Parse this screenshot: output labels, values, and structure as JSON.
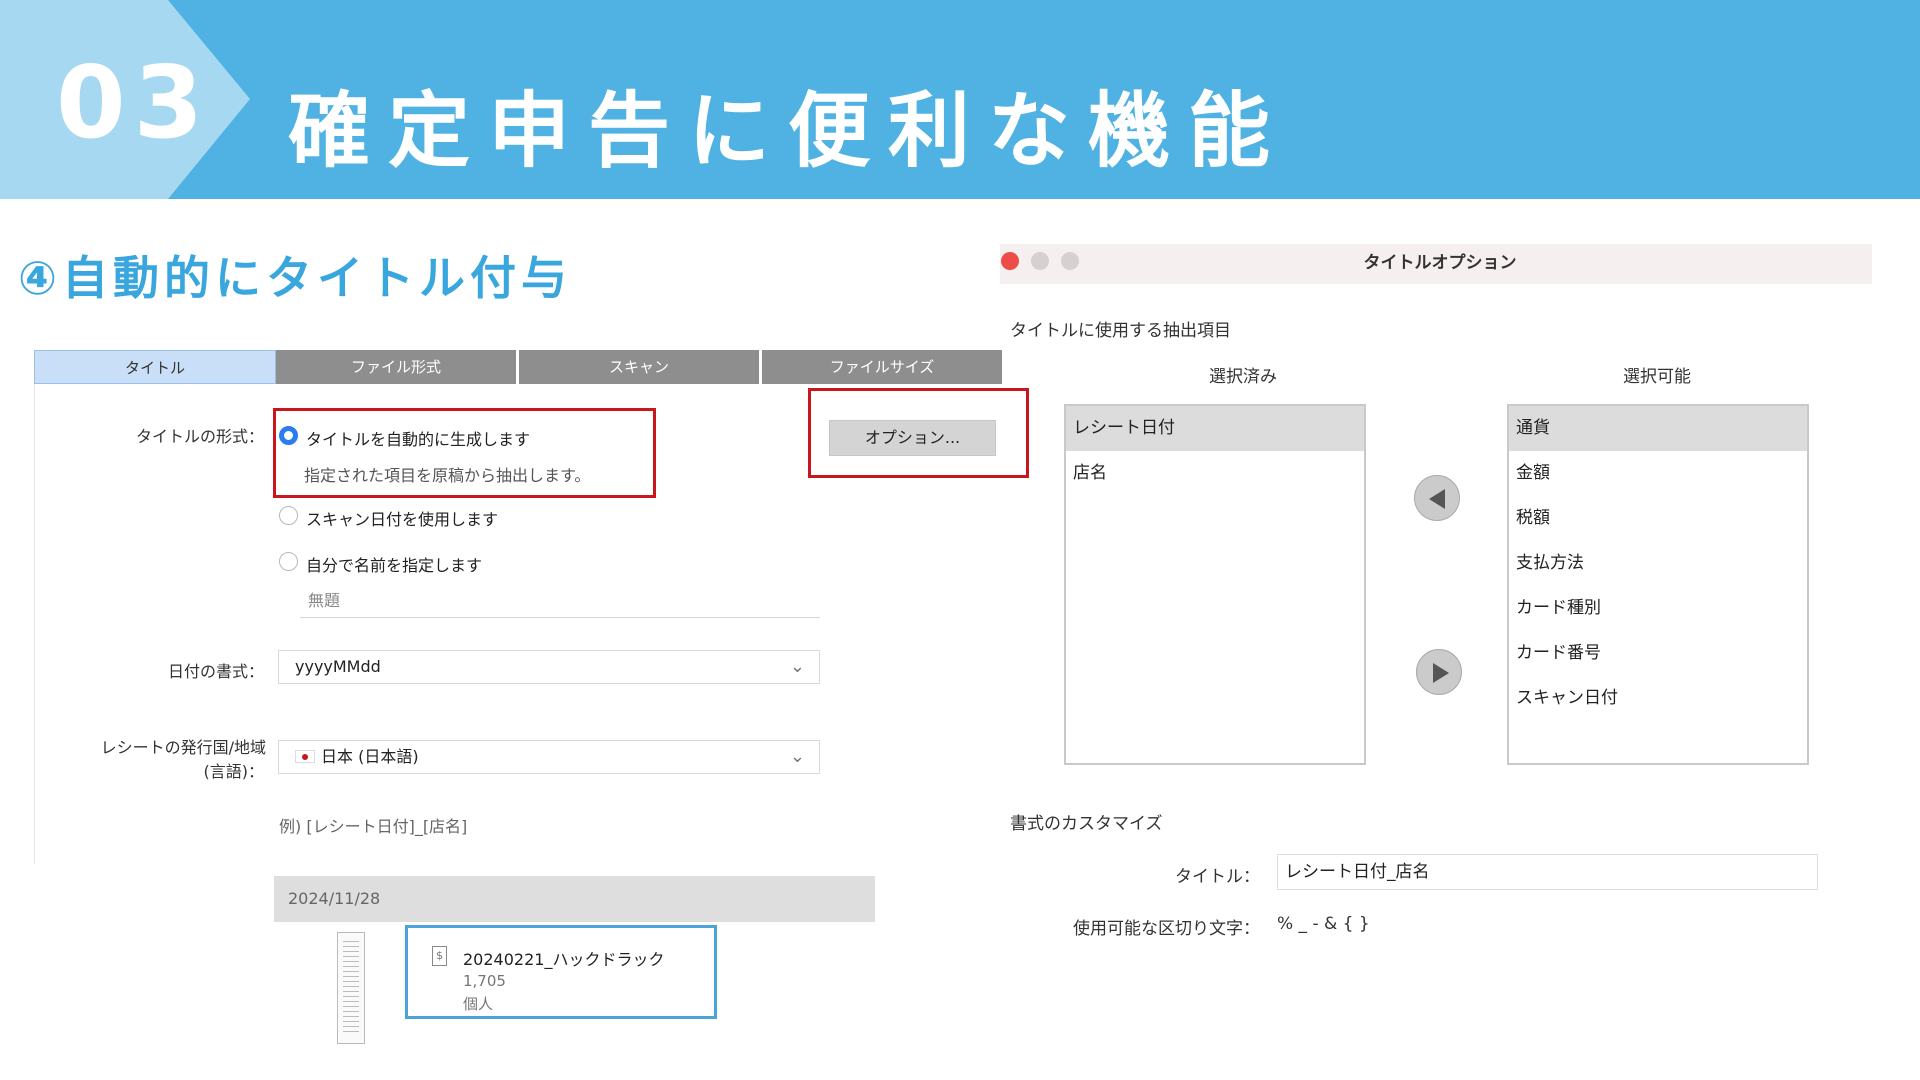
{
  "header": {
    "number": "03",
    "title": "確定申告に便利な機能"
  },
  "section_title": "④自動的にタイトル付与",
  "settings": {
    "tabs": [
      "タイトル",
      "ファイル形式",
      "スキャン",
      "ファイルサイズ"
    ],
    "active_tab": "タイトル",
    "title_format_label": "タイトルの形式：",
    "option_auto": "タイトルを自動的に生成します",
    "option_auto_desc": "指定された項目を原稿から抽出します。",
    "option_scan_date": "スキャン日付を使用します",
    "option_custom": "自分で名前を指定します",
    "custom_placeholder": "無題",
    "options_button": "オプション...",
    "date_format_label": "日付の書式：",
    "date_format_value": "yyyyMMdd",
    "region_label_1": "レシートの発行国/地域",
    "region_label_2": "(言語)：",
    "region_value": "日本 (日本語)",
    "example": "例) [レシート日付]_[店名]"
  },
  "preview": {
    "date": "2024/11/28",
    "doc_title": "20240221_ハックドラック",
    "doc_amount": "1,705",
    "doc_category": "個人",
    "receipt_icon": "receipt-icon"
  },
  "dialog": {
    "title": "タイトルオプション",
    "extraction_heading": "タイトルに使用する抽出項目",
    "selected_heading": "選択済み",
    "available_heading": "選択可能",
    "selected_items": [
      "レシート日付",
      "店名"
    ],
    "available_items": [
      "通貨",
      "金額",
      "税額",
      "支払方法",
      "カード種別",
      "カード番号",
      "スキャン日付"
    ],
    "customize_heading": "書式のカスタマイズ",
    "title_label": "タイトル：",
    "title_value": "レシート日付_店名",
    "separator_label": "使用可能な区切り文字：",
    "separator_value": "% _ - & { }"
  },
  "colors": {
    "header_blue": "#4fb2e2",
    "header_light": "#a7d8f2",
    "section_blue": "#3aa6de",
    "highlight_red": "#c8161d",
    "radio_blue": "#2b7cf0",
    "card_border": "#4aa3d9"
  }
}
